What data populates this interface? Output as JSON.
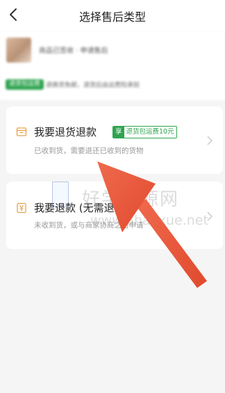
{
  "header": {
    "title": "选择售后类型",
    "back_icon": "chevron-left-icon"
  },
  "product": {
    "name": "商品已签收 · 申请售后",
    "tag": "退货包运费",
    "note": "退换货免邮，退货后由运费险承担"
  },
  "options": [
    {
      "title": "我要退货退款",
      "badge_tag": "享",
      "badge_text": "退货包运费10元",
      "description": "已收到货，需要退还已收到的货物",
      "icon": "box-icon",
      "chevron": "chevron-right-icon"
    },
    {
      "title": "我要退款 (无需退货)",
      "description": "未收到货，或与商家协商之后申请",
      "icon": "yen-icon",
      "chevron": "chevron-right-icon"
    }
  ],
  "watermark": {
    "text": "好学资源网",
    "url": "www.5haoxue.net"
  },
  "colors": {
    "accent_green": "#2ea44f",
    "icon_orange": "#e8a24a",
    "arrow_red": "#e8533a"
  }
}
